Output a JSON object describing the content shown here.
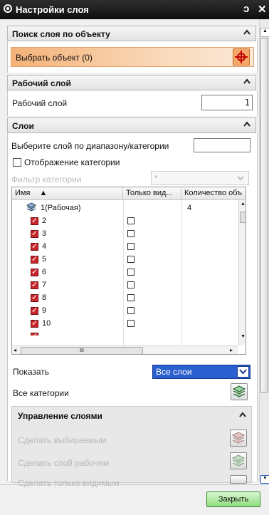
{
  "window": {
    "title": "Настройки слоя"
  },
  "sections": {
    "search": {
      "title": "Поиск слоя по объекту",
      "select_label": "Выбрать объект (0)"
    },
    "work_layer": {
      "title": "Рабочий слой",
      "label": "Рабочий слой",
      "value": "1"
    },
    "layers": {
      "title": "Слои",
      "range_label": "Выберите слой по диапазону/категории",
      "range_value": "",
      "show_category_label": "Отображение категории",
      "filter_label": "Фильтр категории",
      "filter_value": "*"
    }
  },
  "table": {
    "headers": [
      "Имя",
      "Только вид...",
      "Количество объ"
    ],
    "rows": [
      {
        "name": "1(Рабочая)",
        "count": "4"
      },
      {
        "name": "2"
      },
      {
        "name": "3"
      },
      {
        "name": "4"
      },
      {
        "name": "5"
      },
      {
        "name": "6"
      },
      {
        "name": "7"
      },
      {
        "name": "8"
      },
      {
        "name": "9"
      },
      {
        "name": "10"
      }
    ],
    "hscroll_grip": "III"
  },
  "show": {
    "label": "Показать",
    "value": "Все слои"
  },
  "all_categories": {
    "label": "Все категории"
  },
  "management": {
    "title": "Управление слоями",
    "make_selectable": "Сделать выбираемым",
    "make_work": "Сделать слой рабочим",
    "make_visible_only": "Сделать только видимым"
  },
  "footer": {
    "close": "Закрыть"
  },
  "colors": {
    "accent_orange": "#f0a060",
    "selected_blue": "#2a5fd0",
    "close_green": "#8fdc7d"
  }
}
